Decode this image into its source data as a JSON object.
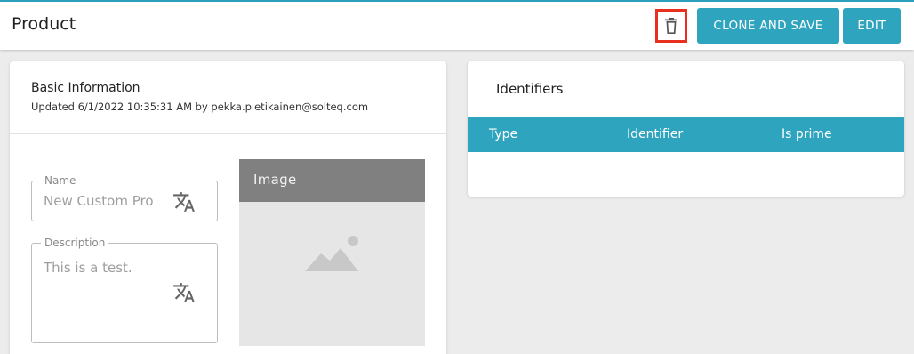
{
  "header": {
    "title": "Product",
    "delete_icon": "trash-icon",
    "clone_label": "CLONE AND SAVE",
    "edit_label": "EDIT",
    "accent_color": "#2fa4bf",
    "highlight_color": "#e8301f"
  },
  "basic_info": {
    "title": "Basic Information",
    "updated": "Updated 6/1/2022 10:35:31 AM by pekka.pietikainen@solteq.com",
    "name": {
      "label": "Name",
      "value": "New Custom Pro",
      "icon": "translate-icon"
    },
    "description": {
      "label": "Description",
      "value": "This is a test.",
      "icon": "translate-icon"
    },
    "image": {
      "label": "Image",
      "icon": "image-placeholder-icon"
    }
  },
  "identifiers": {
    "title": "Identifiers",
    "columns": [
      "Type",
      "Identifier",
      "Is prime"
    ],
    "rows": []
  }
}
